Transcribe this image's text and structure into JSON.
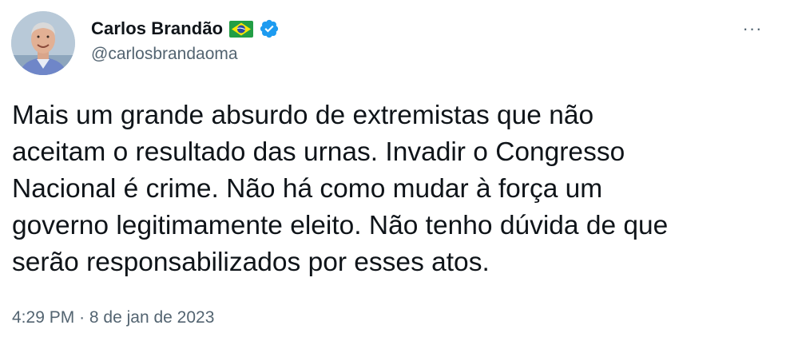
{
  "author": {
    "display_name": "Carlos Brandão",
    "handle": "@carlosbrandaoma",
    "flag_icon": "brazil-flag-icon",
    "verified_icon": "verified-badge-icon",
    "verified_color": "#1d9bf0"
  },
  "menu": {
    "more_label": "···"
  },
  "tweet": {
    "text_lines": [
      "Mais um grande absurdo de extremistas que não",
      "aceitam o resultado das urnas. Invadir o Congresso",
      "Nacional é crime. Não há como mudar à força um",
      "governo legitimamente eleito. Não tenho dúvida de que",
      "serão responsabilizados por esses atos."
    ],
    "time": "4:29 PM",
    "separator": "·",
    "date": "8 de jan de 2023"
  },
  "colors": {
    "text_primary": "#0f1419",
    "text_secondary": "#536471",
    "background": "#ffffff"
  }
}
